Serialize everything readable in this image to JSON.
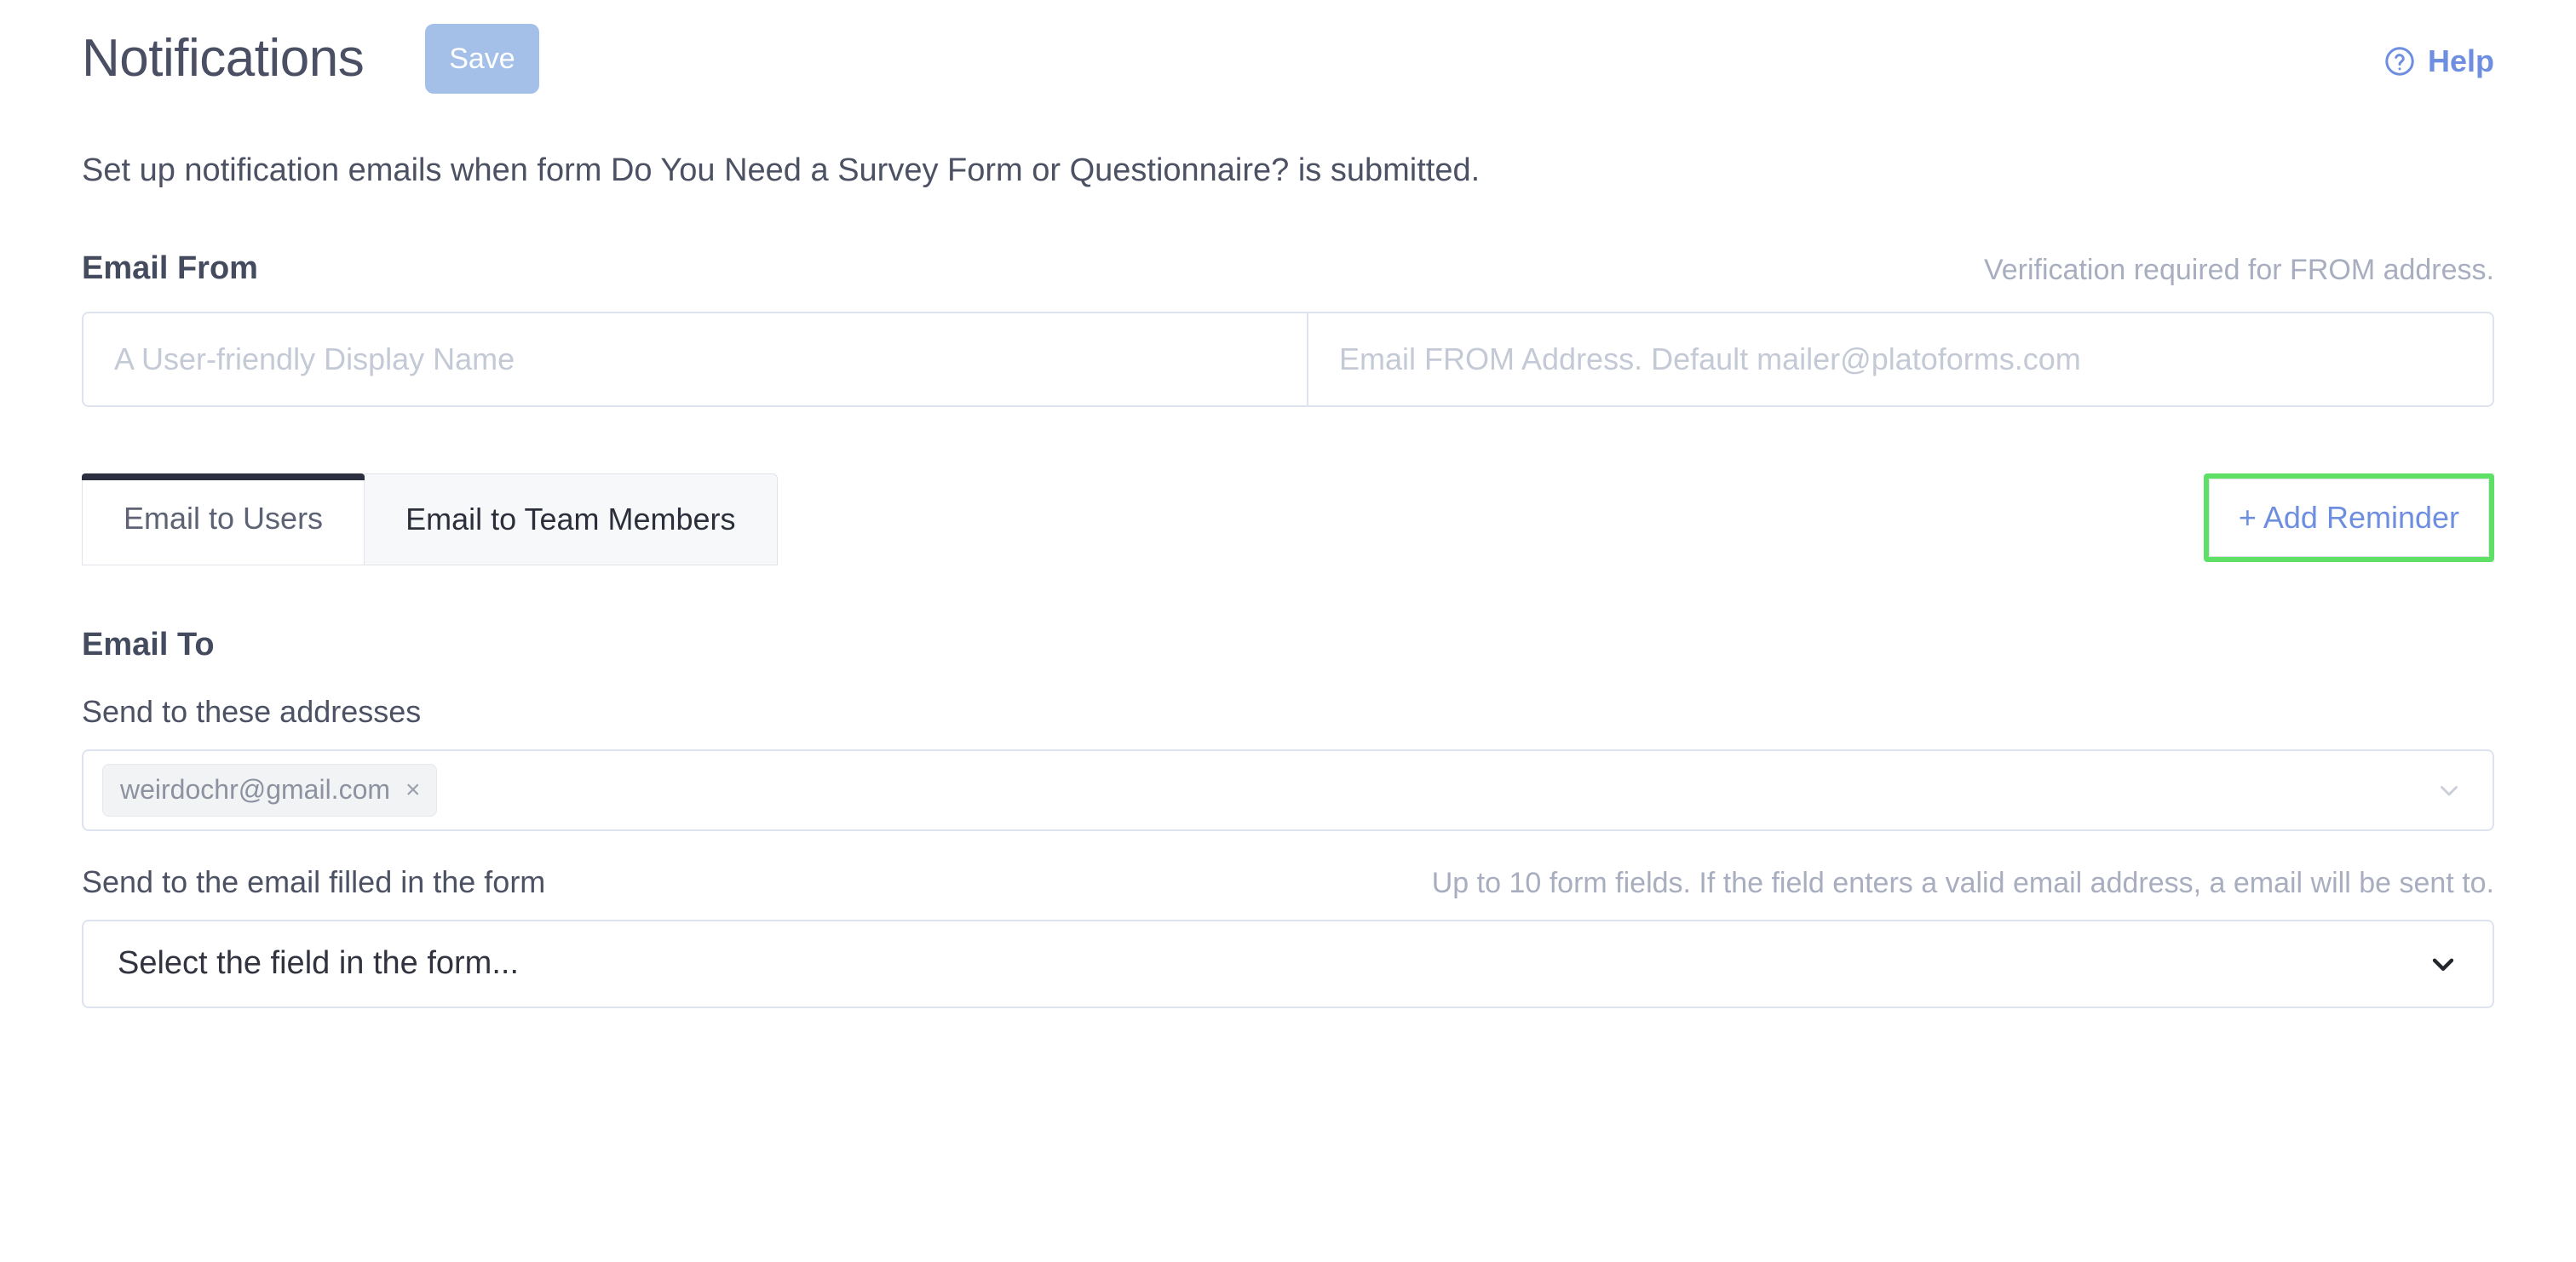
{
  "header": {
    "title": "Notifications",
    "save_label": "Save",
    "help_label": "Help",
    "help_icon": "question-circle-icon"
  },
  "description": "Set up notification emails when form Do You Need a Survey Form or Questionnaire? is submitted.",
  "email_from": {
    "section_title": "Email From",
    "note": "Verification required for FROM address.",
    "display_name_placeholder": "A User-friendly Display Name",
    "display_name_value": "",
    "from_address_placeholder": "Email FROM Address. Default mailer@platoforms.com",
    "from_address_value": ""
  },
  "tabs": [
    {
      "label": "Email to Users",
      "active": true
    },
    {
      "label": "Email to Team Members",
      "active": false
    }
  ],
  "add_reminder": {
    "label": "+ Add Reminder",
    "highlight_color": "#5ee066"
  },
  "email_to": {
    "section_title": "Email To",
    "addresses_label": "Send to these addresses",
    "tags": [
      {
        "email": "weirdochr@gmail.com",
        "remove_icon": "close-icon"
      }
    ],
    "dropdown_icon": "chevron-down-icon",
    "form_field_label": "Send to the email filled in the form",
    "form_field_hint": "Up to 10 form fields. If the field enters a valid email address, a email will be sent to.",
    "form_field_placeholder": "Select the field in the form...",
    "form_field_value": ""
  },
  "colors": {
    "save_button": "#a4c0e9",
    "help_link": "#6e8fe0",
    "accent_link": "#6e8fe0",
    "active_tab_bar": "#2b2f3e",
    "highlight_border": "#5ee066",
    "text_primary": "#454b5e",
    "text_muted": "#a8aebf",
    "border": "#dfe3ed"
  }
}
